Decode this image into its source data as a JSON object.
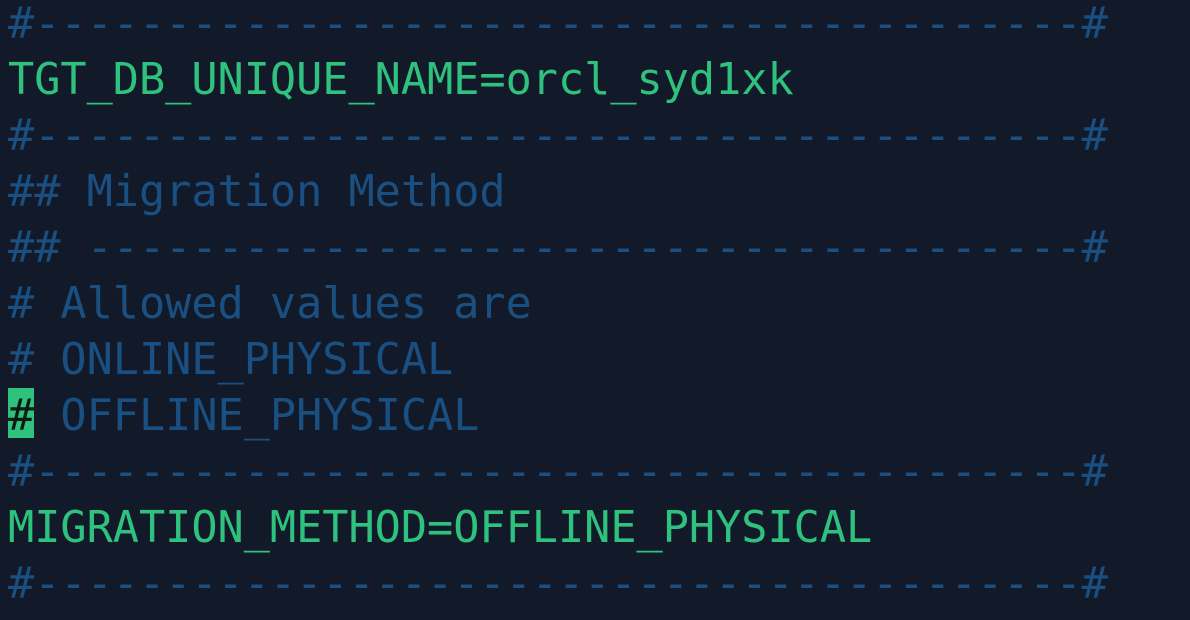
{
  "terminal": {
    "lines": [
      {
        "text": "#----------------------------------------#",
        "kind": "comment"
      },
      {
        "text": "TGT_DB_UNIQUE_NAME=orcl_syd1xk",
        "kind": "code"
      },
      {
        "text": "#----------------------------------------#",
        "kind": "comment"
      },
      {
        "text": "## Migration Method",
        "kind": "comment"
      },
      {
        "text": "## --------------------------------------#",
        "kind": "comment"
      },
      {
        "text": "# Allowed values are",
        "kind": "comment"
      },
      {
        "text": "# ONLINE_PHYSICAL",
        "kind": "comment"
      },
      {
        "cursor_char": "#",
        "rest": " OFFLINE_PHYSICAL",
        "kind": "comment"
      },
      {
        "text": "#----------------------------------------#",
        "kind": "comment"
      },
      {
        "text": "MIGRATION_METHOD=OFFLINE_PHYSICAL",
        "kind": "code"
      },
      {
        "text": "#----------------------------------------#",
        "kind": "comment"
      }
    ],
    "colors": {
      "background": "#121a29",
      "comment": "#1a4f82",
      "code": "#2ec27e",
      "cursor": "#2ec27e"
    }
  }
}
